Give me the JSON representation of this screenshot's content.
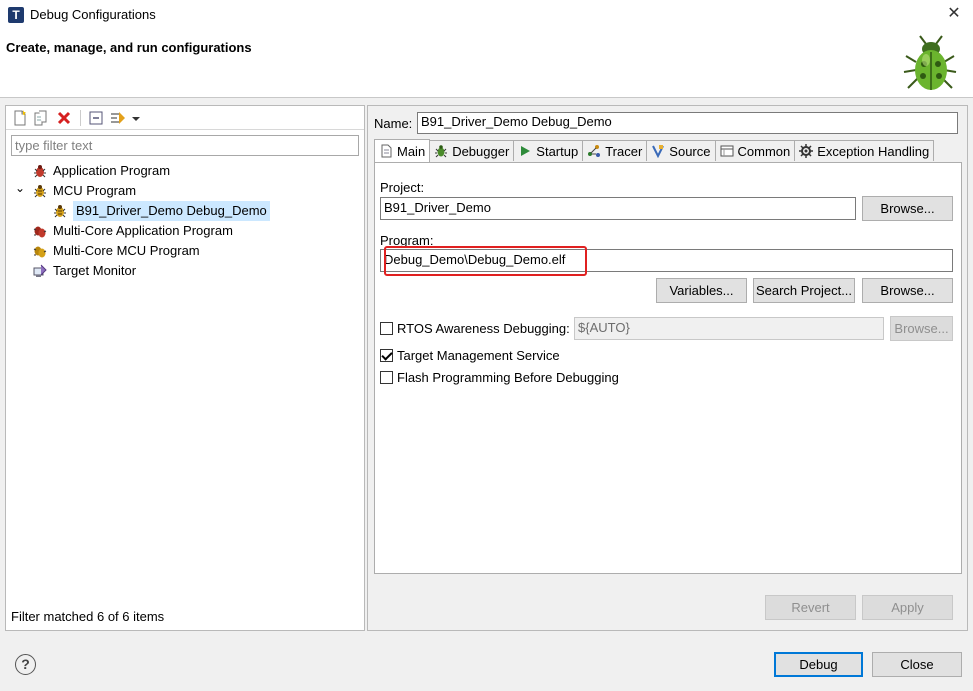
{
  "window": {
    "title": "Debug Configurations",
    "app_icon_letter": "T",
    "close_glyph": "✕"
  },
  "banner": {
    "title": "Create, manage, and run configurations"
  },
  "left": {
    "filter_placeholder": "type filter text",
    "filter_value": "",
    "tree": [
      {
        "label": "Application Program",
        "icon": "bug-icon",
        "level": 0
      },
      {
        "label": "MCU Program",
        "icon": "bug-icon",
        "level": 0,
        "expanded": true
      },
      {
        "label": "B91_Driver_Demo Debug_Demo",
        "icon": "bug-icon",
        "level": 1,
        "selected": true
      },
      {
        "label": "Multi-Core Application Program",
        "icon": "multi-bug-icon",
        "level": 0
      },
      {
        "label": "Multi-Core MCU Program",
        "icon": "multi-bug-icon",
        "level": 0
      },
      {
        "label": "Target Monitor",
        "icon": "monitor-icon",
        "level": 0
      }
    ],
    "expander_glyph": "⌄",
    "status": "Filter matched 6 of 6 items"
  },
  "right": {
    "name_label": "Name:",
    "name_value": "B91_Driver_Demo Debug_Demo",
    "tabs": [
      {
        "label": "Main",
        "icon": "document-icon",
        "active": true
      },
      {
        "label": "Debugger",
        "icon": "bug-gear-icon"
      },
      {
        "label": "Startup",
        "icon": "play-icon"
      },
      {
        "label": "Tracer",
        "icon": "tracer-icon"
      },
      {
        "label": "Source",
        "icon": "source-icon"
      },
      {
        "label": "Common",
        "icon": "common-icon"
      },
      {
        "label": "Exception Handling",
        "icon": "gear-icon"
      }
    ],
    "project_label": "Project:",
    "project_value": "B91_Driver_Demo",
    "browse_label": "Browse...",
    "program_label": "Program:",
    "program_value": "Debug_Demo\\Debug_Demo.elf",
    "variables_label": "Variables...",
    "search_project_label": "Search Project...",
    "rtos_label": "RTOS Awareness Debugging:",
    "rtos_checked": false,
    "rtos_value": "${AUTO}",
    "target_mgmt_label": "Target Management Service",
    "target_mgmt_checked": true,
    "flash_label": "Flash Programming Before Debugging",
    "flash_checked": false,
    "revert_label": "Revert",
    "apply_label": "Apply"
  },
  "footer": {
    "help_glyph": "?",
    "debug_label": "Debug",
    "close_label": "Close"
  },
  "colors": {
    "highlight": "#e02020",
    "selection": "#cce8ff",
    "default_button_border": "#0078d7"
  }
}
